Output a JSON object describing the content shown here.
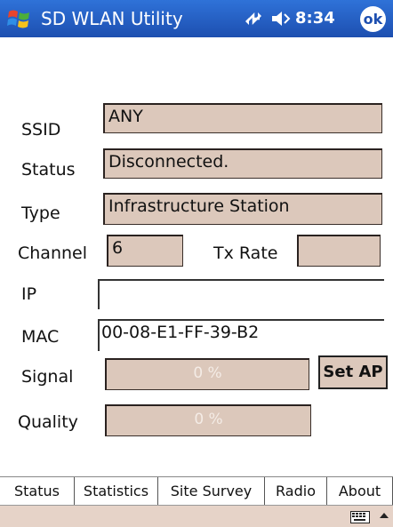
{
  "titlebar": {
    "title": "SD WLAN Utility",
    "time": "8:34",
    "ok_label": "ok"
  },
  "labels": {
    "ssid": "SSID",
    "status": "Status",
    "type": "Type",
    "channel": "Channel",
    "tx_rate": "Tx Rate",
    "ip": "IP",
    "mac": "MAC",
    "signal": "Signal",
    "quality": "Quality"
  },
  "values": {
    "ssid": "ANY",
    "status": "Disconnected.",
    "type": "Infrastructure Station",
    "channel": "6",
    "tx_rate": "",
    "ip": "",
    "mac": "00-08-E1-FF-39-B2",
    "signal_text": "0 %",
    "quality_text": "0 %",
    "signal_level": 0,
    "quality_level": 0
  },
  "set_ap_label": "Set AP",
  "tabs": [
    "Status",
    "Statistics",
    "Site Survey",
    "Radio",
    "About"
  ],
  "active_tab": "Status",
  "colors": {
    "titlebar": "#1d4fb0",
    "field": "#dcc8bb"
  }
}
